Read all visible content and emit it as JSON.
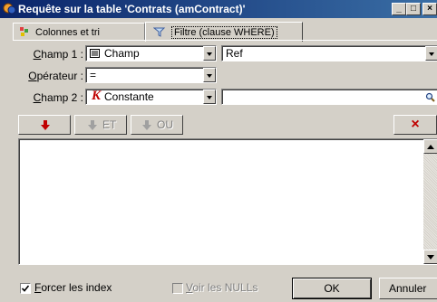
{
  "window": {
    "title": "Requête sur la table 'Contrats (amContract)'",
    "controls": {
      "minimize": "_",
      "maximize": "□",
      "close": "×"
    }
  },
  "tabs": [
    {
      "label": "Colonnes et tri",
      "icon": "columns-icon",
      "selected": false
    },
    {
      "label": "Filtre (clause WHERE)",
      "icon": "filter-icon",
      "selected": true
    }
  ],
  "form": {
    "champ1": {
      "label_prefix": "C",
      "label_rest": "hamp 1 :",
      "type_value": "Champ",
      "type_icon": "field-icon",
      "value": "Ref"
    },
    "operateur": {
      "label_prefix": "O",
      "label_rest": "pérateur :",
      "value": "="
    },
    "champ2": {
      "label_prefix": "C",
      "label_rest": "hamp 2 :",
      "type_value": "Constante",
      "type_icon": "constant-icon",
      "value": ""
    }
  },
  "toolbar": {
    "insert_label": "",
    "et_label": "ET",
    "ou_label": "OU",
    "delete_label": "×"
  },
  "footer": {
    "force_index": {
      "label_prefix": "F",
      "label_rest": "orcer les index",
      "checked": true
    },
    "show_nulls": {
      "label_prefix": "V",
      "label_rest": "oir les NULLs",
      "checked": false,
      "disabled": true
    },
    "ok_label": "OK",
    "cancel_label": "Annuler"
  },
  "colors": {
    "title_start": "#0a246a",
    "title_end": "#3a6ea5",
    "face": "#d4d0c8",
    "arrow_red": "#c00000"
  }
}
